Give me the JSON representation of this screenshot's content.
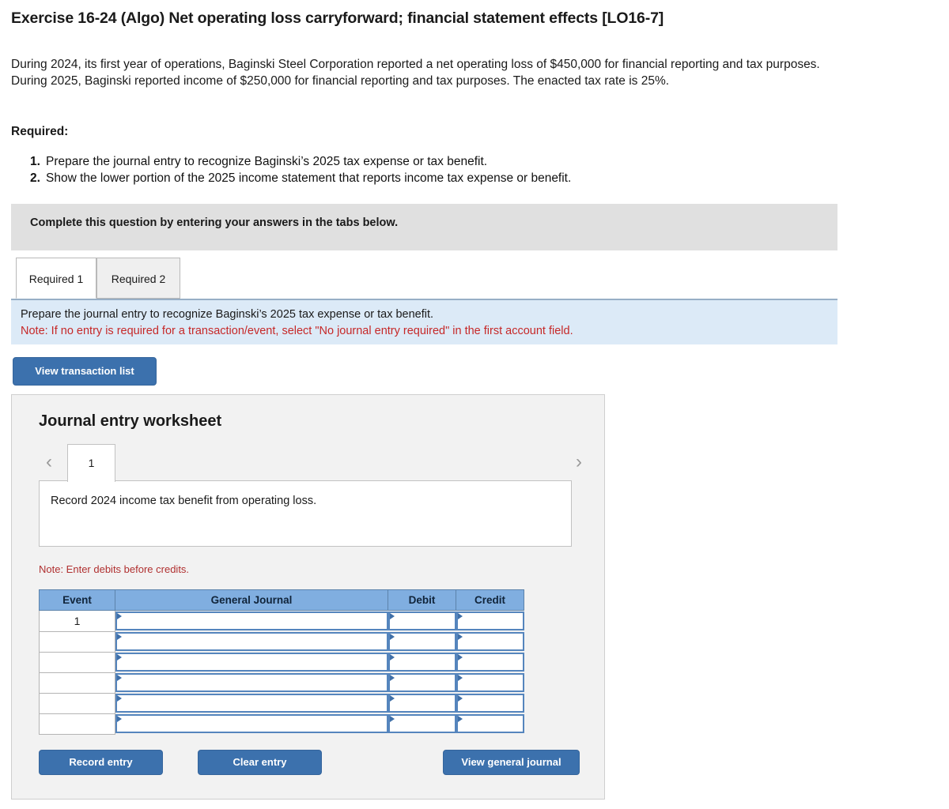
{
  "exercise": {
    "title": "Exercise 16-24 (Algo) Net operating loss carryforward; financial statement effects [LO16-7]",
    "problem": "During 2024, its first year of operations, Baginski Steel Corporation reported a net operating loss of $450,000 for financial reporting and tax purposes. During 2025, Baginski reported income of $250,000 for financial reporting and tax purposes. The enacted tax rate is 25%.",
    "required_label": "Required:",
    "required_items": [
      {
        "num": "1.",
        "text": "Prepare the journal entry to recognize Baginski’s 2025 tax expense or tax benefit."
      },
      {
        "num": "2.",
        "text": "Show the lower portion of the 2025 income statement that reports income tax expense or benefit."
      }
    ]
  },
  "banner": {
    "text": "Complete this question by entering your answers in the tabs below."
  },
  "tabs": [
    {
      "label": "Required 1",
      "active": true
    },
    {
      "label": "Required 2",
      "active": false
    }
  ],
  "requirement_panel": {
    "instruction": "Prepare the journal entry to recognize Baginski’s 2025 tax expense or tax benefit.",
    "note": "Note: If no entry is required for a transaction/event, select \"No journal entry required\" in the first account field."
  },
  "view_transaction_button": {
    "label": "View transaction list"
  },
  "worksheet": {
    "title": "Journal entry worksheet",
    "prev_arrow": "‹",
    "next_arrow": "›",
    "page_tab": "1",
    "description": "Record 2024 income tax benefit from operating loss.",
    "note": "Note: Enter debits before credits.",
    "table": {
      "headers": [
        "Event",
        "General Journal",
        "Debit",
        "Credit"
      ],
      "rows": [
        {
          "event": "1",
          "journal": "",
          "debit": "",
          "credit": ""
        },
        {
          "event": "",
          "journal": "",
          "debit": "",
          "credit": ""
        },
        {
          "event": "",
          "journal": "",
          "debit": "",
          "credit": ""
        },
        {
          "event": "",
          "journal": "",
          "debit": "",
          "credit": ""
        },
        {
          "event": "",
          "journal": "",
          "debit": "",
          "credit": ""
        },
        {
          "event": "",
          "journal": "",
          "debit": "",
          "credit": ""
        }
      ]
    },
    "buttons": {
      "record_entry": "Record entry",
      "clear_entry": "Clear entry",
      "view_general_journal": "View general journal"
    }
  },
  "colors": {
    "accent_blue": "#3c71ad",
    "table_header_blue": "#80aee0",
    "panel_blue": "#dceaf7",
    "banner_gray": "#e0e0e0",
    "note_red": "#c62828",
    "card_gray": "#f2f2f2"
  }
}
